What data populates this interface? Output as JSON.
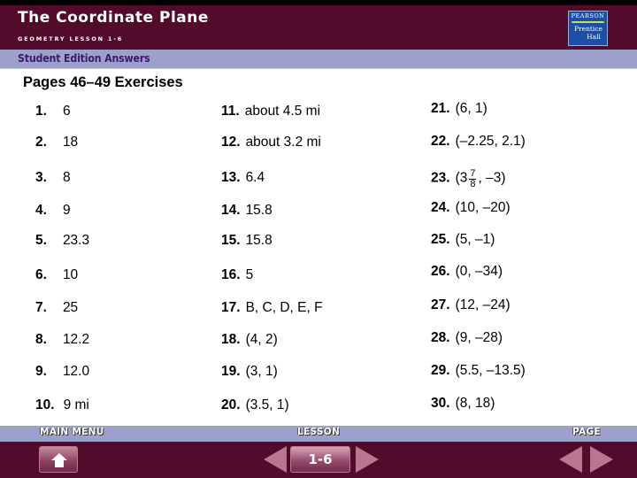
{
  "header": {
    "title": "The Coordinate Plane",
    "subtitle": "GEOMETRY LESSON 1-6",
    "logo": {
      "top": "PEARSON",
      "line1": "Prentice",
      "line2": "Hall"
    }
  },
  "band": {
    "label": "Student Edition Answers"
  },
  "section": {
    "title": "Pages 46–49  Exercises"
  },
  "answers": {
    "col1": [
      {
        "num": "1.",
        "text": "6"
      },
      {
        "num": "2.",
        "text": "18"
      },
      {
        "num": "3.",
        "text": "8"
      },
      {
        "num": "4.",
        "text": "9"
      },
      {
        "num": "5.",
        "text": "23.3"
      },
      {
        "num": "6.",
        "text": "10"
      },
      {
        "num": "7.",
        "text": "25"
      },
      {
        "num": "8.",
        "text": "12.2"
      },
      {
        "num": "9.",
        "text": "12.0"
      },
      {
        "num": "10.",
        "text": "9 mi"
      }
    ],
    "col2": [
      {
        "num": "11.",
        "text": "about 4.5 mi"
      },
      {
        "num": "12.",
        "text": "about 3.2 mi"
      },
      {
        "num": "13.",
        "text": "6.4"
      },
      {
        "num": "14.",
        "text": "15.8"
      },
      {
        "num": "15.",
        "text": "15.8"
      },
      {
        "num": "16.",
        "text": "5"
      },
      {
        "num": "17.",
        "text": "B, C, D, E, F"
      },
      {
        "num": "18.",
        "text": "(4, 2)"
      },
      {
        "num": "19.",
        "text": "(3, 1)"
      },
      {
        "num": "20.",
        "text": "(3.5, 1)"
      }
    ],
    "col3": [
      {
        "num": "21.",
        "text": "(6, 1)"
      },
      {
        "num": "22.",
        "text": "(–2.25, 2.1)"
      },
      {
        "num": "23.",
        "pre": "(3",
        "frac_num": "7",
        "frac_den": "8",
        "post": ", –3)"
      },
      {
        "num": "24.",
        "text": "(10, –20)"
      },
      {
        "num": "25.",
        "text": "(5, –1)"
      },
      {
        "num": "26.",
        "text": "(0, –34)"
      },
      {
        "num": "27.",
        "text": "(12, –24)"
      },
      {
        "num": "28.",
        "text": "(9, –28)"
      },
      {
        "num": "29.",
        "text": "(5.5, –13.5)"
      },
      {
        "num": "30.",
        "text": "(8, 18)"
      }
    ]
  },
  "footer": {
    "main_menu_label": "MAIN MENU",
    "lesson_label": "LESSON",
    "page_label": "PAGE",
    "lesson_value": "1-6"
  },
  "icons": {
    "home": "home-icon",
    "prev": "triangle-left-icon",
    "next": "triangle-right-icon"
  },
  "colors": {
    "header_maroon": "#520b2a",
    "band_lavender": "#9ea0cc",
    "band_text": "#3a1a6e",
    "logo_blue": "#1d4fa6"
  }
}
